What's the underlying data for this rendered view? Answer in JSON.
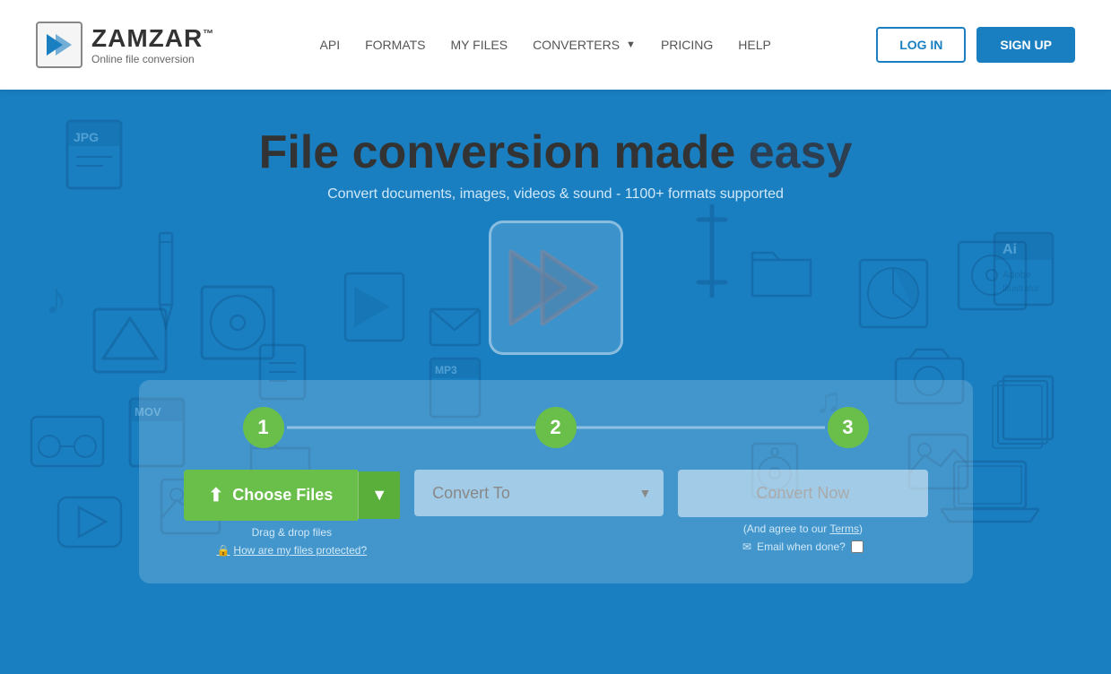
{
  "navbar": {
    "logo_name": "ZAMZAR",
    "logo_tm": "™",
    "logo_sub": "Online file conversion",
    "nav_api": "API",
    "nav_formats": "FORMATS",
    "nav_myfiles": "MY FILES",
    "nav_converters": "CONVERTERS",
    "nav_pricing": "PRICING",
    "nav_help": "HELP",
    "btn_login": "LOG IN",
    "btn_signup": "SIGN UP"
  },
  "hero": {
    "title_normal": "File conversion made ",
    "title_bold": "easy",
    "subtitle": "Convert documents, images, videos & sound - 1100+ formats supported"
  },
  "steps": {
    "step1": "1",
    "step2": "2",
    "step3": "3"
  },
  "form": {
    "choose_files": "Choose Files",
    "choose_files_dropdown": "▼",
    "drag_drop": "Drag & drop files",
    "protection_link": "How are my files protected?",
    "convert_to_placeholder": "Convert To",
    "convert_now": "Convert Now",
    "agree_text": "(And agree to our ",
    "agree_link": "Terms",
    "agree_close": ")",
    "email_label": "Email when done?",
    "upload_icon": "⬆"
  },
  "colors": {
    "accent_blue": "#1a7fc1",
    "accent_green": "#6abf4b",
    "brand_dark": "#333"
  }
}
